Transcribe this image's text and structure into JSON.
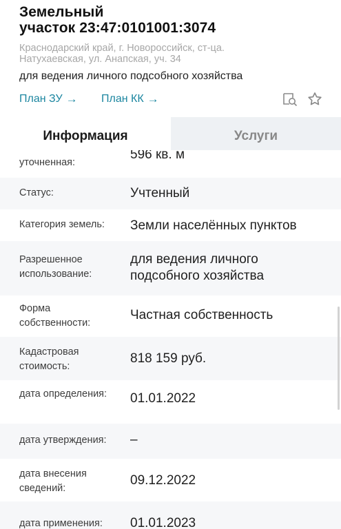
{
  "header": {
    "title_line1": "Земельный",
    "title_line2": "участок 23:47:0101001:3074",
    "address_line1": "Краснодарский край, г. Новороссийск, ст-ца.",
    "address_line2": "Натухаевская, ул. Анапская, уч. 34",
    "purpose": "для ведения личного подсобного хозяйства"
  },
  "links": {
    "plan_zu": "План ЗУ",
    "plan_kk": "План КК",
    "arrow": "→"
  },
  "icons": {
    "map": "map-search-icon",
    "favorite": "star-outline-icon"
  },
  "tabs": {
    "info": "Информация",
    "services": "Услуги"
  },
  "rows": [
    {
      "label": "уточненная:",
      "value": "596 кв. м"
    },
    {
      "label": "Статус:",
      "value": "Учтенный"
    },
    {
      "label": "Категория земель:",
      "value": "Земли населённых пунктов"
    },
    {
      "label": "Разрешенное использование:",
      "value": "для ведения личного подсобного хозяйства"
    },
    {
      "label": "Форма собственности:",
      "value": "Частная собственность"
    },
    {
      "label": "Кадастровая стоимость:",
      "value": "818 159 руб."
    },
    {
      "label": "дата определения:",
      "value": "01.01.2022"
    },
    {
      "label": "дата утверждения:",
      "value": "–"
    },
    {
      "label": "дата внесения сведений:",
      "value": "09.12.2022"
    },
    {
      "label": "дата применения:",
      "value": "01.01.2023"
    }
  ],
  "colors": {
    "link": "#1c86a0",
    "tab_inactive_bg": "#eef1f4",
    "row_alt_bg": "#f6f7f9"
  }
}
